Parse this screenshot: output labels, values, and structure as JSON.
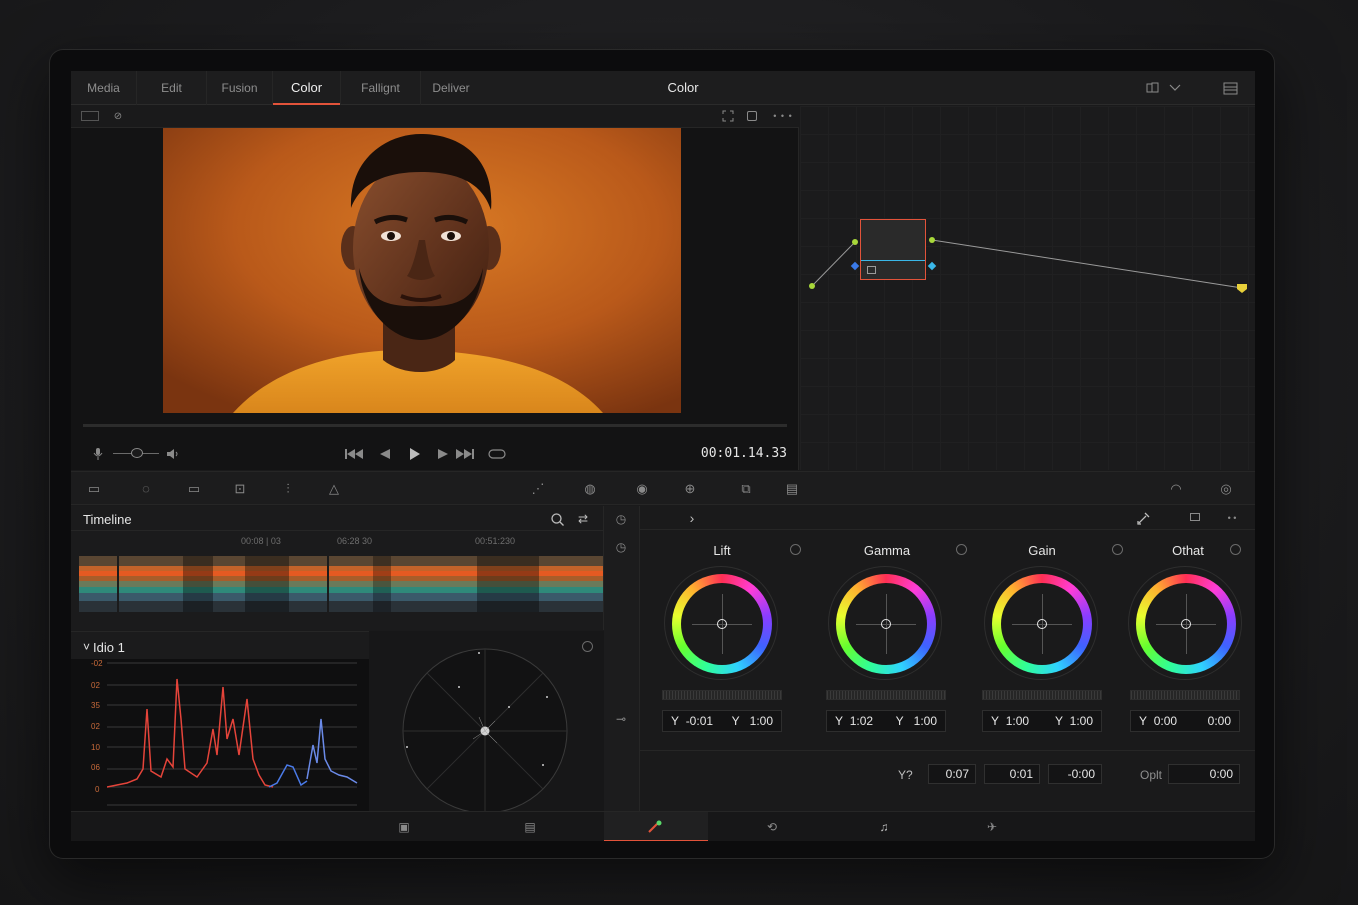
{
  "nav": {
    "tabs": [
      {
        "label": "Media"
      },
      {
        "label": "Edit"
      },
      {
        "label": "Fusion"
      },
      {
        "label": "Color"
      },
      {
        "label": "Fallignt"
      },
      {
        "label": "Deliver"
      }
    ],
    "active_tab": "Color",
    "title": "Color"
  },
  "viewer": {
    "timecode": "00:01.14.33"
  },
  "timeline": {
    "title": "Timeline",
    "timecodes": [
      "00:08 | 03",
      "06:28 30",
      "00:51:230"
    ]
  },
  "scopes": {
    "title": "Idio 1",
    "y_labels": [
      "-02",
      "02",
      "35",
      "02",
      "10",
      "06",
      "0"
    ]
  },
  "wheels": [
    {
      "name": "Lift",
      "left_label": "Y",
      "left_value": "-0:01",
      "right_label": "Y",
      "right_value": "1:00"
    },
    {
      "name": "Gamma",
      "left_label": "Y",
      "left_value": "1:02",
      "right_label": "Y",
      "right_value": "1:00"
    },
    {
      "name": "Gain",
      "left_label": "Y",
      "left_value": "1:00",
      "right_label": "Y",
      "right_value": "1:00"
    },
    {
      "name": "Othat",
      "left_label": "Y",
      "left_value": "0:00",
      "right_label": "",
      "right_value": "0:00"
    }
  ],
  "adjust": {
    "y_label": "Y?",
    "y_values": [
      "0:07",
      "0:01",
      "-0:00"
    ],
    "opt_label": "Oplt",
    "opt_value": "0:00"
  },
  "colors": {
    "accent": "#e2533a",
    "node_outline": "#e2533a",
    "node_input": "#a8d83a",
    "node_output": "#3ab7e8"
  },
  "icons": [
    "mic-icon",
    "audio-icon",
    "skip-back-icon",
    "step-back-icon",
    "play-icon",
    "step-forward-icon",
    "skip-forward-icon",
    "loop-icon",
    "search-icon",
    "shuffle-icon",
    "chevron-right-icon",
    "eyedropper-icon"
  ]
}
